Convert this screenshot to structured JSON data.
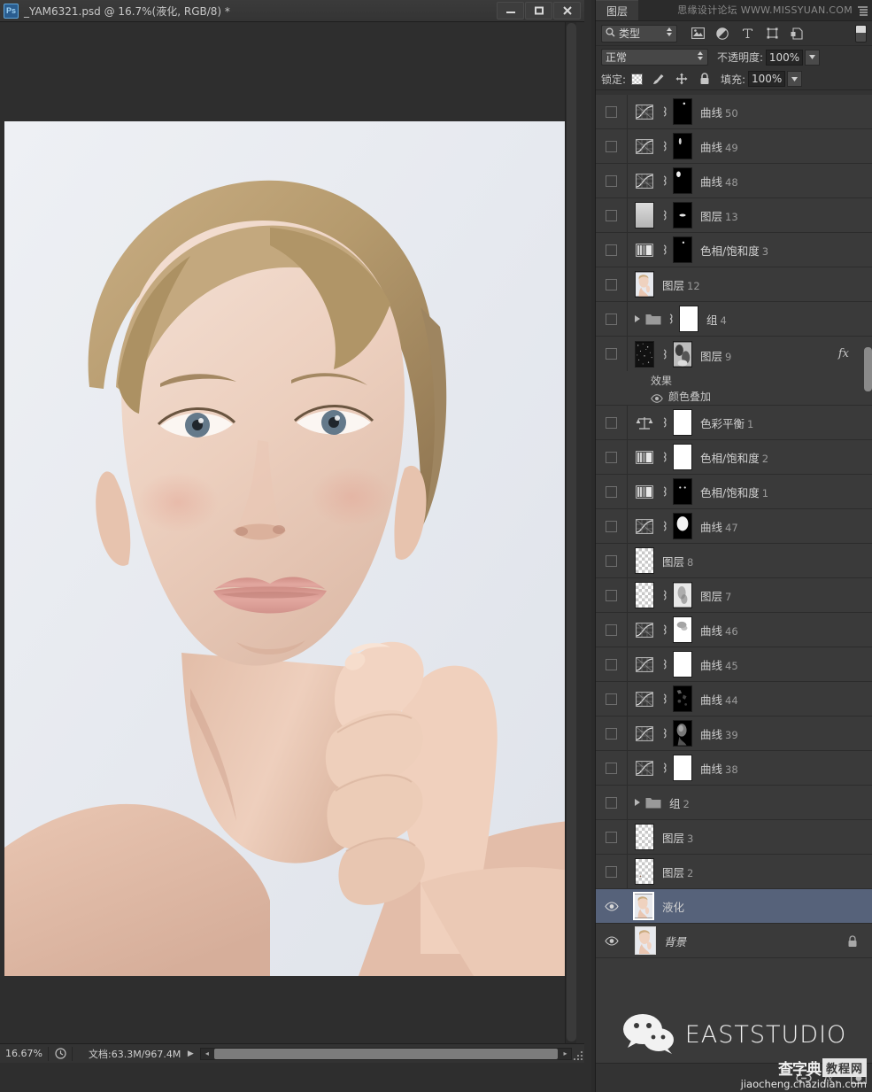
{
  "window": {
    "app_badge": "Ps",
    "title": "_YAM6321.psd @ 16.7%(液化, RGB/8) *",
    "minimize_label": "minimize",
    "maximize_label": "maximize",
    "close_label": "close"
  },
  "statusbar": {
    "zoom": "16.67%",
    "doc_info": "文档:63.3M/967.4M",
    "play": "▶",
    "left_arrow": "◂",
    "right_arrow": "▸"
  },
  "panel": {
    "tab_label": "图层",
    "watermark": "思缘设计论坛 WWW.MISSYUAN.COM",
    "filter": {
      "kind_label": "类型",
      "icons": [
        "pixel-filter-icon",
        "adjustment-filter-icon",
        "type-filter-icon",
        "shape-filter-icon",
        "smart-object-filter-icon"
      ]
    },
    "blend": {
      "mode": "正常",
      "opacity_label": "不透明度:",
      "opacity_value": "100%"
    },
    "lock": {
      "label": "锁定:",
      "fill_label": "填充:",
      "fill_value": "100%",
      "icons": [
        "lock-transparent-icon",
        "lock-image-icon",
        "lock-position-icon",
        "lock-all-icon"
      ]
    },
    "bottom_icons": [
      "link-layers-icon",
      "layer-style-fx-icon",
      "add-mask-icon"
    ],
    "watermark_bottom_cn1": "查字典",
    "watermark_bottom_cn2": "教程网",
    "watermark_bottom_url": "jiaocheng.chazidian.com",
    "watermark_studio": "EASTSTUDIO"
  },
  "layers": [
    {
      "name": "曲线",
      "num": "50",
      "type": "adjustment",
      "adj": "curves",
      "mask": "black-dot",
      "visible": false,
      "linked": true
    },
    {
      "name": "曲线",
      "num": "49",
      "type": "adjustment",
      "adj": "curves",
      "mask": "black-streak",
      "visible": false,
      "linked": true
    },
    {
      "name": "曲线",
      "num": "48",
      "type": "adjustment",
      "adj": "curves",
      "mask": "black-blob",
      "visible": false,
      "linked": true
    },
    {
      "name": "图层",
      "num": "13",
      "type": "pixel",
      "thumb": "gray-gradient",
      "mask": "black-dash",
      "visible": false,
      "linked": true
    },
    {
      "name": "色相/饱和度",
      "num": "3",
      "type": "adjustment",
      "adj": "huesat",
      "mask": "black-dot",
      "visible": false,
      "linked": true
    },
    {
      "name": "图层",
      "num": "12",
      "type": "pixel",
      "thumb": "portrait",
      "visible": false,
      "linked": false
    },
    {
      "name": "组",
      "num": "4",
      "type": "group",
      "mask": "white",
      "visible": false,
      "linked": true
    },
    {
      "name": "图层",
      "num": "9",
      "type": "pixel-fx",
      "thumb": "noise",
      "mask": "gray-blob",
      "visible": false,
      "linked": true,
      "fx_label": "效果",
      "fx_effect": "颜色叠加",
      "fx_badge": "fx"
    },
    {
      "name": "色彩平衡",
      "num": "1",
      "type": "adjustment",
      "adj": "balance",
      "mask": "white",
      "visible": false,
      "linked": true
    },
    {
      "name": "色相/饱和度",
      "num": "2",
      "type": "adjustment",
      "adj": "huesat",
      "mask": "white",
      "visible": false,
      "linked": true
    },
    {
      "name": "色相/饱和度",
      "num": "1",
      "type": "adjustment",
      "adj": "huesat",
      "mask": "black-two-dots",
      "visible": false,
      "linked": true
    },
    {
      "name": "曲线",
      "num": "47",
      "type": "adjustment",
      "adj": "curves",
      "mask": "white-oval",
      "visible": false,
      "linked": true
    },
    {
      "name": "图层",
      "num": "8",
      "type": "pixel",
      "thumb": "checker",
      "visible": false,
      "linked": false
    },
    {
      "name": "图层",
      "num": "7",
      "type": "pixel",
      "thumb": "checker",
      "mask": "gray-smudge",
      "visible": false,
      "linked": true
    },
    {
      "name": "曲线",
      "num": "46",
      "type": "adjustment",
      "adj": "curves",
      "mask": "white-smudge",
      "visible": false,
      "linked": true
    },
    {
      "name": "曲线",
      "num": "45",
      "type": "adjustment",
      "adj": "curves",
      "mask": "white",
      "visible": false,
      "linked": true
    },
    {
      "name": "曲线",
      "num": "44",
      "type": "adjustment",
      "adj": "curves",
      "mask": "black-speckle",
      "visible": false,
      "linked": true
    },
    {
      "name": "曲线",
      "num": "39",
      "type": "adjustment",
      "adj": "curves",
      "mask": "dark-portrait",
      "visible": false,
      "linked": true
    },
    {
      "name": "曲线",
      "num": "38",
      "type": "adjustment",
      "adj": "curves",
      "mask": "white",
      "visible": false,
      "linked": true
    },
    {
      "name": "组",
      "num": "2",
      "type": "group",
      "visible": false,
      "linked": false
    },
    {
      "name": "图层",
      "num": "3",
      "type": "pixel",
      "thumb": "checker",
      "visible": false,
      "linked": false
    },
    {
      "name": "图层",
      "num": "2",
      "type": "pixel",
      "thumb": "checker-dot",
      "visible": false,
      "linked": false
    },
    {
      "name": "液化",
      "num": "",
      "type": "pixel",
      "thumb": "portrait",
      "visible": true,
      "selected": true,
      "linked": false
    },
    {
      "name": "背景",
      "num": "",
      "type": "pixel",
      "thumb": "portrait",
      "visible": true,
      "locked": true,
      "italic": true,
      "linked": false
    }
  ]
}
